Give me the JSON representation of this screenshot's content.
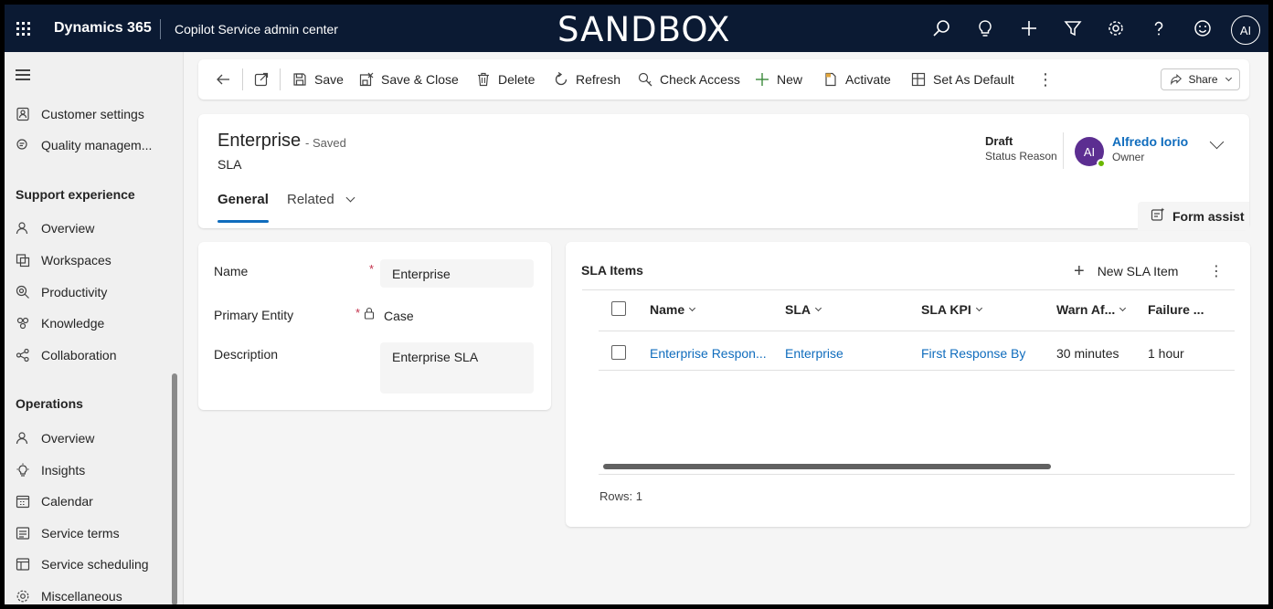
{
  "topbar": {
    "brand": "Dynamics 365",
    "app_name": "Copilot Service admin center",
    "environment_banner": "SANDBOX",
    "icons": [
      "search-icon",
      "lightbulb-icon",
      "plus-icon",
      "filter-icon",
      "gear-icon",
      "help-icon",
      "smiley-icon"
    ],
    "avatar_initials": "AI"
  },
  "sidebar": {
    "items_top": [
      {
        "label": "Customer settings",
        "icon": "customer-settings-icon"
      },
      {
        "label": "Quality managem...",
        "icon": "quality-icon"
      }
    ],
    "section1": {
      "title": "Support experience",
      "items": [
        {
          "label": "Overview",
          "icon": "people-icon"
        },
        {
          "label": "Workspaces",
          "icon": "workspaces-icon"
        },
        {
          "label": "Productivity",
          "icon": "productivity-icon"
        },
        {
          "label": "Knowledge",
          "icon": "knowledge-icon"
        },
        {
          "label": "Collaboration",
          "icon": "collaboration-icon"
        }
      ]
    },
    "section2": {
      "title": "Operations",
      "items": [
        {
          "label": "Overview",
          "icon": "people-icon"
        },
        {
          "label": "Insights",
          "icon": "insights-icon"
        },
        {
          "label": "Calendar",
          "icon": "calendar-icon"
        },
        {
          "label": "Service terms",
          "icon": "service-terms-icon"
        },
        {
          "label": "Service scheduling",
          "icon": "scheduling-icon"
        },
        {
          "label": "Miscellaneous",
          "icon": "gear-icon"
        }
      ]
    }
  },
  "commandbar": {
    "save": "Save",
    "save_close": "Save & Close",
    "delete": "Delete",
    "refresh": "Refresh",
    "check_access": "Check Access",
    "new": "New",
    "activate": "Activate",
    "set_default": "Set As Default",
    "share": "Share"
  },
  "record": {
    "title": "Enterprise",
    "saved_status": "- Saved",
    "entity": "SLA",
    "tabs": [
      "General",
      "Related"
    ],
    "status_value": "Draft",
    "status_label": "Status Reason",
    "owner_initials": "AI",
    "owner_name": "Alfredo Iorio",
    "owner_label": "Owner",
    "form_assist": "Form assist"
  },
  "form": {
    "name_label": "Name",
    "name_value": "Enterprise",
    "primary_entity_label": "Primary Entity",
    "primary_entity_value": "Case",
    "description_label": "Description",
    "description_value": "Enterprise SLA",
    "required_mark": "*"
  },
  "grid": {
    "title": "SLA Items",
    "new_item": "New SLA Item",
    "columns": [
      "Name",
      "SLA",
      "SLA KPI",
      "Warn Af...",
      "Failure ..."
    ],
    "rows": [
      [
        "Enterprise Respon...",
        "Enterprise",
        "First Response By",
        "30 minutes",
        "1 hour"
      ]
    ],
    "rows_count": "Rows: 1"
  },
  "colors": {
    "topbar": "#0b1a33",
    "link": "#0f6cbd",
    "owner_avatar": "#5c2e91"
  }
}
